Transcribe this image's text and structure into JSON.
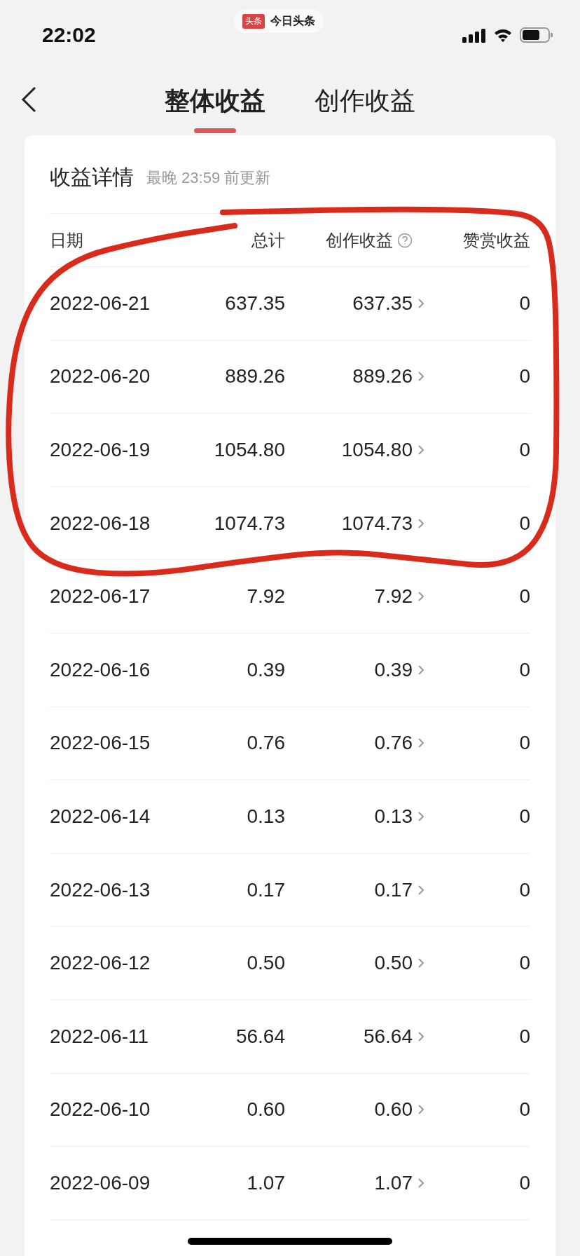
{
  "status_bar": {
    "time": "22:02",
    "app_badge": {
      "logo": "头条",
      "name": "今日头条"
    }
  },
  "tabs": [
    {
      "label": "整体收益",
      "selected": true
    },
    {
      "label": "创作收益",
      "selected": false
    }
  ],
  "card": {
    "title": "收益详情",
    "subtitle": "最晚 23:59 前更新",
    "columns": [
      {
        "label": "日期"
      },
      {
        "label": "总计"
      },
      {
        "label": "创作收益",
        "help": true
      },
      {
        "label": "赞赏收益"
      }
    ],
    "rows": [
      {
        "date": "2022-06-21",
        "total": "637.35",
        "creative": "637.35",
        "reward": "0"
      },
      {
        "date": "2022-06-20",
        "total": "889.26",
        "creative": "889.26",
        "reward": "0"
      },
      {
        "date": "2022-06-19",
        "total": "1054.80",
        "creative": "1054.80",
        "reward": "0"
      },
      {
        "date": "2022-06-18",
        "total": "1074.73",
        "creative": "1074.73",
        "reward": "0"
      },
      {
        "date": "2022-06-17",
        "total": "7.92",
        "creative": "7.92",
        "reward": "0"
      },
      {
        "date": "2022-06-16",
        "total": "0.39",
        "creative": "0.39",
        "reward": "0"
      },
      {
        "date": "2022-06-15",
        "total": "0.76",
        "creative": "0.76",
        "reward": "0"
      },
      {
        "date": "2022-06-14",
        "total": "0.13",
        "creative": "0.13",
        "reward": "0"
      },
      {
        "date": "2022-06-13",
        "total": "0.17",
        "creative": "0.17",
        "reward": "0"
      },
      {
        "date": "2022-06-12",
        "total": "0.50",
        "creative": "0.50",
        "reward": "0"
      },
      {
        "date": "2022-06-11",
        "total": "56.64",
        "creative": "56.64",
        "reward": "0"
      },
      {
        "date": "2022-06-10",
        "total": "0.60",
        "creative": "0.60",
        "reward": "0"
      },
      {
        "date": "2022-06-09",
        "total": "1.07",
        "creative": "1.07",
        "reward": "0"
      }
    ]
  },
  "annotation": {
    "kind": "circle",
    "color": "#d92b1c"
  }
}
